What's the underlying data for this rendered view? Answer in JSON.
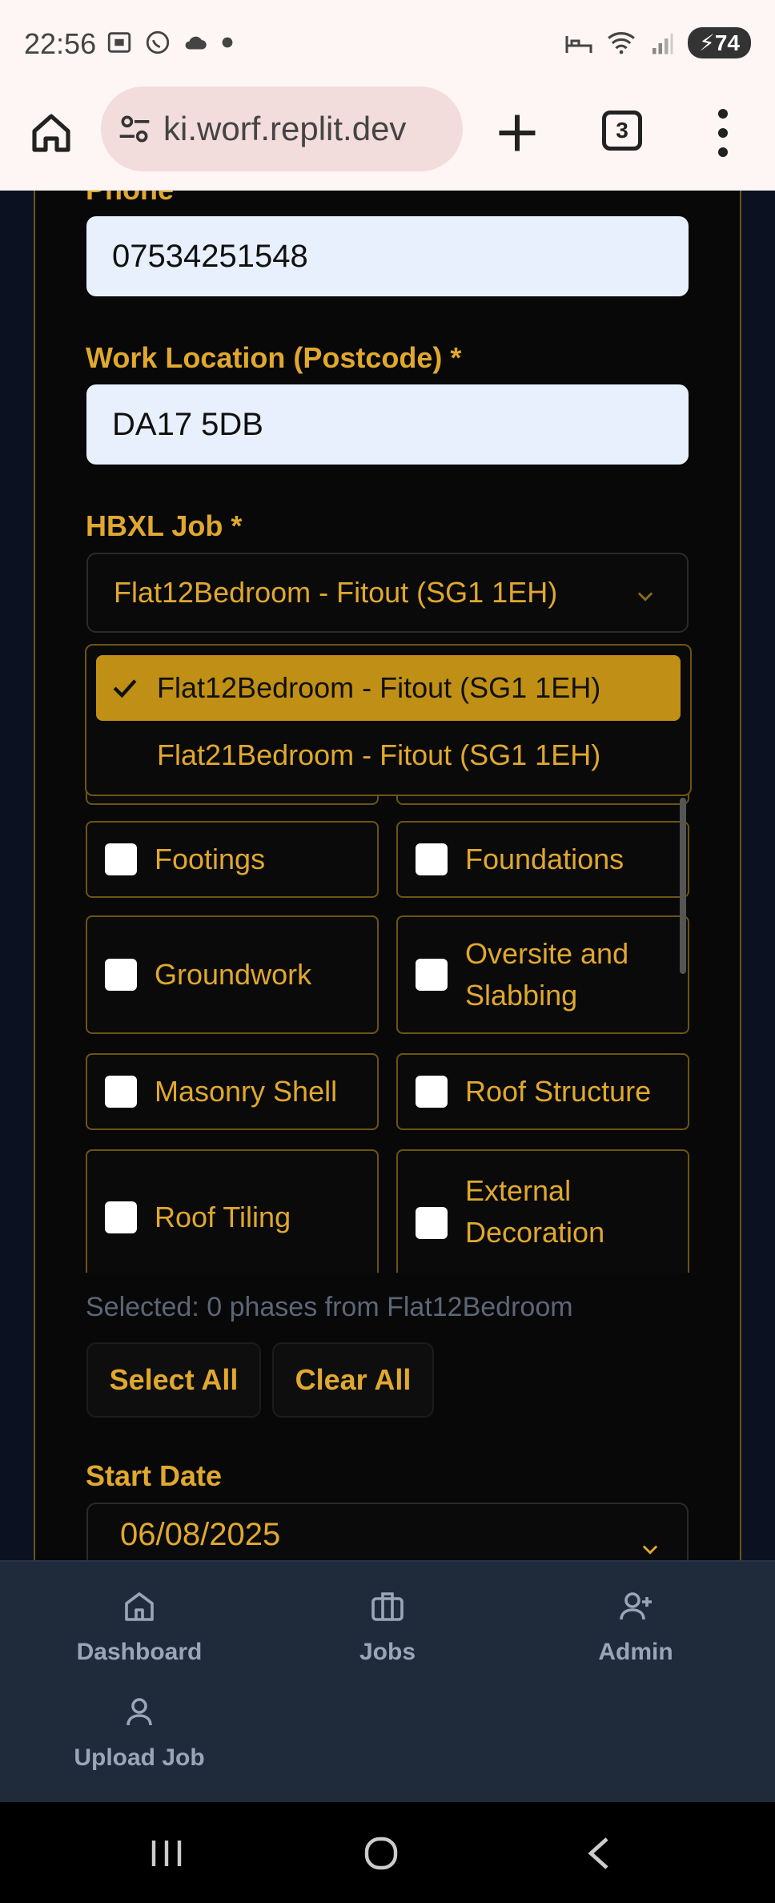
{
  "status_bar": {
    "time": "22:56",
    "battery": "74",
    "icons": [
      "screenshot-icon",
      "whatsapp-icon",
      "cloud-icon",
      "dot-icon",
      "bed-icon",
      "wifi-icon",
      "signal-icon"
    ]
  },
  "browser": {
    "url": "ki.worf.replit.dev",
    "tabs_count": "3"
  },
  "form": {
    "phone_label": "Phone",
    "phone_value": "07534251548",
    "postcode_label": "Work Location (Postcode) *",
    "postcode_value": "DA17 5DB",
    "job_label": "HBXL Job *",
    "job_selected": "Flat12Bedroom - Fitout (SG1 1EH)",
    "job_options": [
      {
        "label": "Flat12Bedroom - Fitout (SG1 1EH)",
        "selected": true
      },
      {
        "label": "Flat21Bedroom - Fitout (SG1 1EH)",
        "selected": false
      }
    ],
    "phases": [
      {
        "label": "Footings",
        "checked": false
      },
      {
        "label": "Foundations",
        "checked": false
      },
      {
        "label": "Groundwork",
        "checked": false
      },
      {
        "label": "Oversite and Slabbing",
        "checked": false
      },
      {
        "label": "Masonry Shell",
        "checked": false
      },
      {
        "label": "Roof Structure",
        "checked": false
      },
      {
        "label": "Roof Tiling",
        "checked": false
      },
      {
        "label": "External Decoration",
        "checked": false
      }
    ],
    "selected_summary": "Selected: 0 phases from Flat12Bedroom",
    "select_all_label": "Select All",
    "clear_all_label": "Clear All",
    "start_date_label": "Start Date",
    "start_date_value": "06/08/2025"
  },
  "bottom_nav": {
    "items": [
      {
        "label": "Dashboard",
        "icon": "home-icon"
      },
      {
        "label": "Jobs",
        "icon": "briefcase-icon"
      },
      {
        "label": "Admin",
        "icon": "user-plus-icon"
      },
      {
        "label": "Upload Job",
        "icon": "user-icon"
      }
    ]
  },
  "colors": {
    "accent": "#e0a82e",
    "selected_option_bg": "#c08f15",
    "card_bg": "#080808",
    "page_bg": "#0b1120",
    "nav_bg": "#1f2a3a",
    "input_bg": "#e8f0fe"
  }
}
